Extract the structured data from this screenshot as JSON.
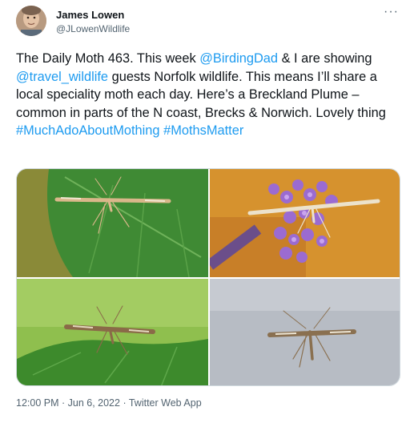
{
  "author": {
    "name": "James Lowen",
    "handle": "@JLowenWildlife"
  },
  "tweet": {
    "segments": [
      {
        "text": "The Daily Moth 463. This week ",
        "link": false
      },
      {
        "text": "@BirdingDad",
        "link": true,
        "kind": "mention"
      },
      {
        "text": " & I are showing ",
        "link": false
      },
      {
        "text": "@travel_wildlife",
        "link": true,
        "kind": "mention"
      },
      {
        "text": " guests Norfolk wildlife. This means I’ll share a local speciality moth each day. Here’s a Breckland Plume – common in parts of the N coast, Brecks & Norwich. Lovely thing ",
        "link": false
      },
      {
        "text": "#MuchAdoAboutMothing",
        "link": true,
        "kind": "hashtag"
      },
      {
        "text": " ",
        "link": false
      },
      {
        "text": "#MothsMatter",
        "link": true,
        "kind": "hashtag"
      }
    ]
  },
  "media": {
    "photos": [
      {
        "subject": "plume moth on green leaf"
      },
      {
        "subject": "plume moth on purple verbena flower"
      },
      {
        "subject": "plume moth on leaf edge, green background"
      },
      {
        "subject": "plume moth on grey background"
      }
    ]
  },
  "meta": {
    "time": "12:00 PM",
    "separator": " · ",
    "date": "Jun 6, 2022",
    "source": "Twitter Web App"
  },
  "icons": {
    "more": "more-horizontal-icon"
  },
  "colors": {
    "link": "#1d9bf0",
    "text": "#0f1419",
    "secondary": "#536471"
  }
}
